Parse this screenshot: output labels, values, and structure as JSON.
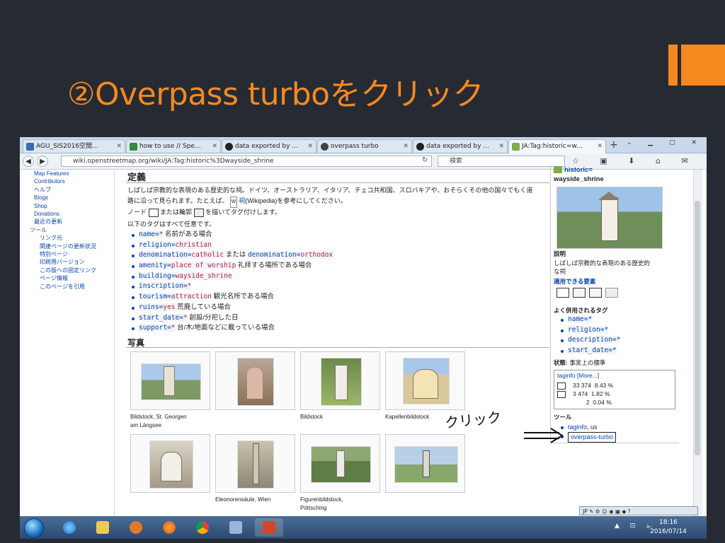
{
  "slide": {
    "title": "②Overpass turboをクリック",
    "accent_color": "#f5891f",
    "background_color": "#262a33"
  },
  "browser": {
    "tabs": [
      {
        "label": "AGU_SIS2016空間...",
        "icon": "page-icon",
        "active": false
      },
      {
        "label": "how to use // Spe...",
        "icon": "speakerdeck-icon",
        "active": false
      },
      {
        "label": "data exported by ...",
        "icon": "github-icon",
        "active": false
      },
      {
        "label": "overpass turbo",
        "icon": "overpass-icon",
        "active": false
      },
      {
        "label": "data exported by ...",
        "icon": "github-icon",
        "active": false
      },
      {
        "label": "JA:Tag:historic=w...",
        "icon": "osm-icon",
        "active": true
      }
    ],
    "new_tab": "+",
    "url": "wiki.openstreetmap.org/wiki/JA:Tag:historic%3Dwayside_shrine",
    "search_placeholder": "検索"
  },
  "sidebar": {
    "items": [
      {
        "label": "Map Features",
        "level": 1
      },
      {
        "label": "Contributors",
        "level": 1
      },
      {
        "label": "ヘルプ",
        "level": 1
      },
      {
        "label": "Blogs",
        "level": 1
      },
      {
        "label": "Shop",
        "level": 1
      },
      {
        "label": "Donations",
        "level": 1
      },
      {
        "label": "最近の更新",
        "level": 1
      },
      {
        "label": "ツール",
        "level": 0
      },
      {
        "label": "リンク元",
        "level": 2
      },
      {
        "label": "関連ページの更新状況",
        "level": 2
      },
      {
        "label": "特別ページ",
        "level": 2
      },
      {
        "label": "印刷用バージョン",
        "level": 2
      },
      {
        "label": "この版への固定リンク",
        "level": 2
      },
      {
        "label": "ページ情報",
        "level": 2
      },
      {
        "label": "このページを引用",
        "level": 2
      }
    ]
  },
  "content": {
    "heading_definition": "定義",
    "para1_line1": "しばしば宗教的な表現のある歴史的な祠。ドイツ、オーストラリア、イタリア、チェコ共和国、スロバキアや、おそらくその他の国々でもく道",
    "para1_line2a": "路に沿って見られます。たとえば、",
    "para1_link": "祠",
    "para1_line2b": "(Wikipedia)を参考にしてください。",
    "para2a": "ノード",
    "para2b": "または輪郭",
    "para2c": "を描いてタグ付けします。",
    "para3": "以下のタグはすべて任意です。",
    "tags": [
      {
        "key": "name",
        "value": "*",
        "desc": "名前がある場合"
      },
      {
        "key": "religion",
        "value": "christian",
        "desc": ""
      },
      {
        "key": "denomination",
        "value": "catholic",
        "desc": "または",
        "extra_key": "denomination",
        "extra_value": "orthodox"
      },
      {
        "key": "amenity",
        "value": "place of worship",
        "desc": "礼拝する場所である場合"
      },
      {
        "key": "building",
        "value": "wayside_shrine",
        "desc": ""
      },
      {
        "key": "inscription",
        "value": "*",
        "desc": ""
      },
      {
        "key": "tourism",
        "value": "attraction",
        "desc": "観光名所である場合"
      },
      {
        "key": "ruins",
        "value": "yes",
        "desc": "荒廃している場合"
      },
      {
        "key": "start_date",
        "value": "*",
        "desc": "創設/分祀した日"
      },
      {
        "key": "support",
        "value": "*",
        "desc": "台/木/地面などに載っている場合"
      }
    ],
    "heading_photos": "写真",
    "photos": [
      {
        "caption1": "Bildstock, St. Georgen",
        "caption2": "am Längsee"
      },
      {
        "caption1": "",
        "caption2": ""
      },
      {
        "caption1": "Bildstock",
        "caption2": ""
      },
      {
        "caption1": "Kapellenbildstock",
        "caption2": ""
      },
      {
        "caption1": "",
        "caption2": ""
      },
      {
        "caption1": "Eleonorensäule, Wien",
        "caption2": ""
      },
      {
        "caption1": "Figurenbildstock,",
        "caption2": "Pöttsching"
      },
      {
        "caption1": "",
        "caption2": ""
      }
    ]
  },
  "infobox": {
    "title_line1": "historic=",
    "title_line2": "wayside_shrine",
    "desc_label": "説明",
    "desc_line1": "しばしば宗教的な表現のある歴史的",
    "desc_line2": "な祠",
    "usage_label": "適用できる要素",
    "common_tags_label": "よく併用されるタグ",
    "common_tags": [
      {
        "key": "name",
        "value": "*"
      },
      {
        "key": "religion",
        "value": "*"
      },
      {
        "key": "description",
        "value": "*"
      },
      {
        "key": "start_date",
        "value": "*"
      }
    ],
    "status_label": "状態:",
    "status_value": "事実上の標準",
    "taginfo_title": "taginfo",
    "taginfo_more": "[More...]",
    "taginfo_rows": [
      {
        "count": "33 374",
        "pct": "8.43 %"
      },
      {
        "count": "3 474",
        "pct": "1.82 %"
      },
      {
        "count": "2",
        "pct": "0.04 %"
      }
    ],
    "tools_label": "ツール",
    "tool_links": [
      {
        "label": "taginfo",
        "extra": ", us"
      },
      {
        "label": "overpass-turbo",
        "extra": ""
      }
    ]
  },
  "annotation": {
    "handwritten": "クリック"
  },
  "taskbar": {
    "lang": "JP",
    "time": "18:16",
    "date": "2016/07/14"
  }
}
